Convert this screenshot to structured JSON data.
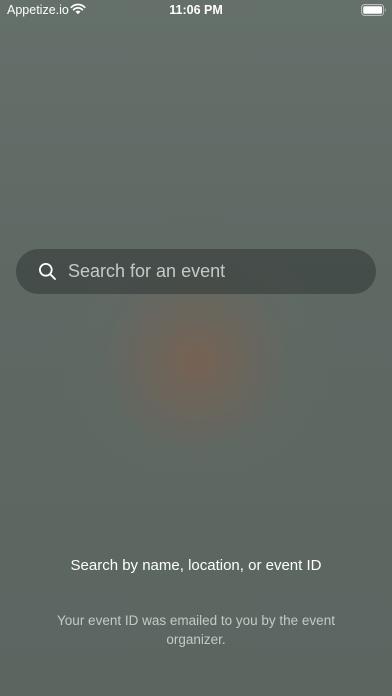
{
  "status_bar": {
    "carrier": "Appetize.io",
    "time": "11:06 PM",
    "icons": [
      "wifi-icon",
      "battery-icon"
    ]
  },
  "search": {
    "placeholder": "Search for an event",
    "value": "",
    "icon": "search-icon"
  },
  "hint": {
    "title": "Search by name, location, or event ID",
    "subtitle": "Your event ID was emailed to you by the event organizer."
  },
  "colors": {
    "background": "#5d6762",
    "search_bar": "#3c4240",
    "text_primary": "#ffffff",
    "text_secondary": "#d7dcd9"
  }
}
